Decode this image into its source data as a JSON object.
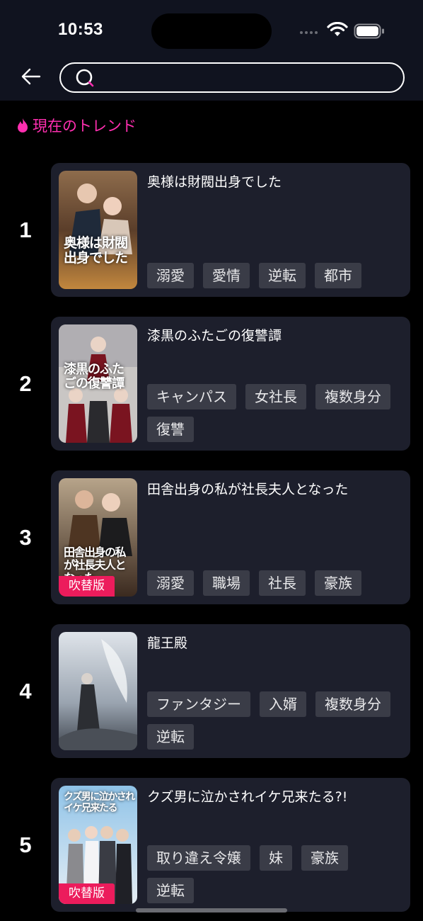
{
  "status_bar": {
    "time": "10:53"
  },
  "search": {
    "value": "",
    "placeholder": ""
  },
  "trend": {
    "title": "現在のトレンド",
    "icon": "flame-icon",
    "accent": "#ff2fb0"
  },
  "dub_badge_color": "#ec1c5c",
  "items": [
    {
      "rank": "1",
      "title": "奥様は財閥出身でした",
      "poster_text": "奥様は財閥出身でした",
      "badge": "",
      "tags": [
        "溺愛",
        "愛情",
        "逆転",
        "都市"
      ]
    },
    {
      "rank": "2",
      "title": "漆黒のふたごの復讐譚",
      "poster_text": "漆黒のふたごの復讐譚",
      "badge": "",
      "tags": [
        "キャンパス",
        "女社長",
        "複数身分",
        "復讐"
      ]
    },
    {
      "rank": "3",
      "title": "田舎出身の私が社長夫人となった",
      "poster_text": "田舎出身の私が社長夫人となった",
      "badge": "吹替版",
      "tags": [
        "溺愛",
        "職場",
        "社長",
        "豪族"
      ]
    },
    {
      "rank": "4",
      "title": "龍王殿",
      "poster_text": "",
      "badge": "",
      "tags": [
        "ファンタジー",
        "入婿",
        "複数身分",
        "逆転"
      ]
    },
    {
      "rank": "5",
      "title": "クズ男に泣かされイケ兄来たる?!",
      "poster_text": "クズ男に泣かされイケ兄来たる",
      "badge": "吹替版",
      "tags": [
        "取り違え令嬢",
        "妹",
        "豪族",
        "逆転"
      ]
    }
  ]
}
